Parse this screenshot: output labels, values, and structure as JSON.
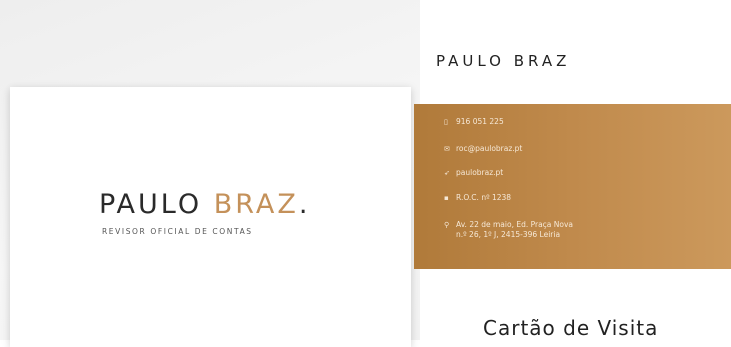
{
  "front": {
    "logo_main": "PAULO ",
    "logo_accent": "BRAZ",
    "logo_dot": ".",
    "tagline": "REVISOR OFICIAL DE CONTAS"
  },
  "back": {
    "name": "PAULO BRAZ",
    "contacts": {
      "phone": "916 051 225",
      "email": "roc@paulobraz.pt",
      "website": "paulobraz.pt",
      "roc": "R.O.C. nº 1238",
      "address_line1": "Av. 22 de maio, Ed. Praça Nova",
      "address_line2": "n.º 26, 1º J, 2415-396 Leiria"
    }
  },
  "caption": "Cartão de Visita",
  "colors": {
    "accent": "#c4915a",
    "band": "#c08a4c",
    "text_dark": "#2a2a2a"
  },
  "icons": [
    "phone-icon",
    "email-icon",
    "website-icon",
    "roc-icon",
    "location-icon"
  ]
}
